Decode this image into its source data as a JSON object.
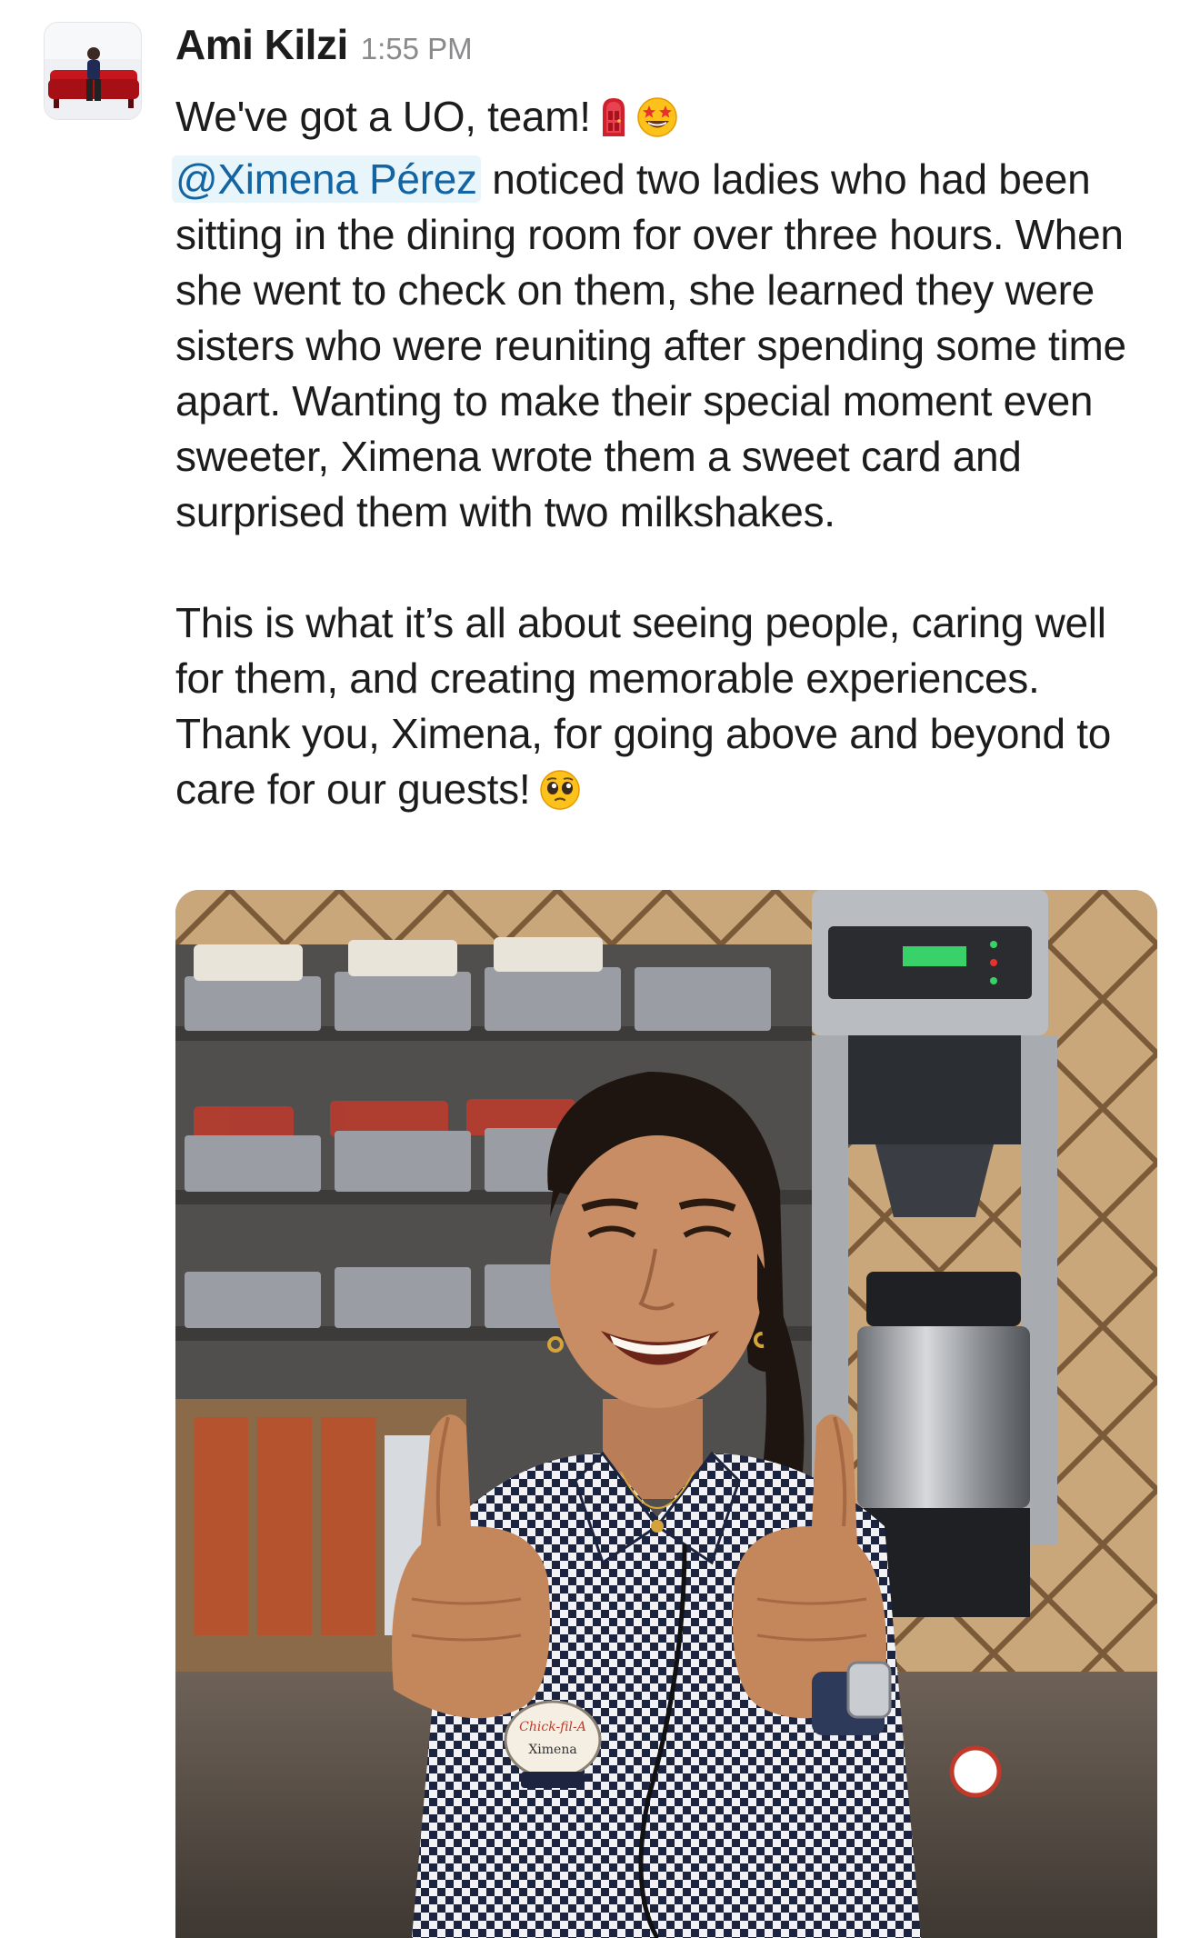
{
  "message": {
    "sender": "Ami Kilzi",
    "timestamp": "1:55 PM",
    "line1": "We've got a UO, team!",
    "line1_emojis": [
      "door-emoji",
      "star-struck-emoji"
    ],
    "mention": "@Ximena Pérez",
    "paragraph1_rest": " noticed two ladies who had been sitting in the dining room for over three hours. When she went to check on them, she learned they were sisters who were reuniting after spending some time apart. Wanting to make their special moment even sweeter, Ximena wrote them a sweet card and surprised them with two milkshakes.",
    "paragraph2": "This is what it’s all about seeing people, caring well for them, and creating memorable experiences. Thank you, Ximena, for going above and beyond to care for our guests!",
    "paragraph2_emoji": "pleading-face-emoji",
    "attachment": {
      "type": "photo",
      "subject": "smiling employee giving two thumbs up",
      "name_tag": "Ximena"
    }
  },
  "colors": {
    "text": "#1d1c1d",
    "timestamp": "#8a8a8d",
    "mention_text": "#1264a3",
    "mention_bg": "#e8f5fa"
  }
}
